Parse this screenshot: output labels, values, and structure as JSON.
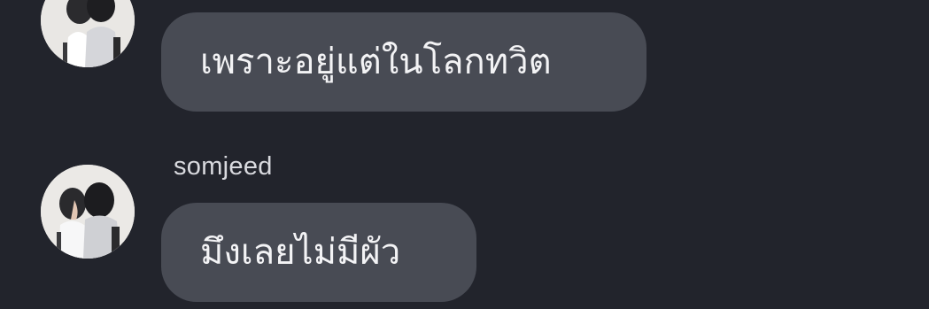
{
  "messages": [
    {
      "sender": "",
      "text": "เพราะอยู่แต่ในโลกทวิต"
    },
    {
      "sender": "somjeed",
      "text": "มึงเลยไม่มีผัว"
    }
  ],
  "theme": {
    "background": "#22242c",
    "bubble": "#484b54",
    "text": "#f3f3f5"
  }
}
